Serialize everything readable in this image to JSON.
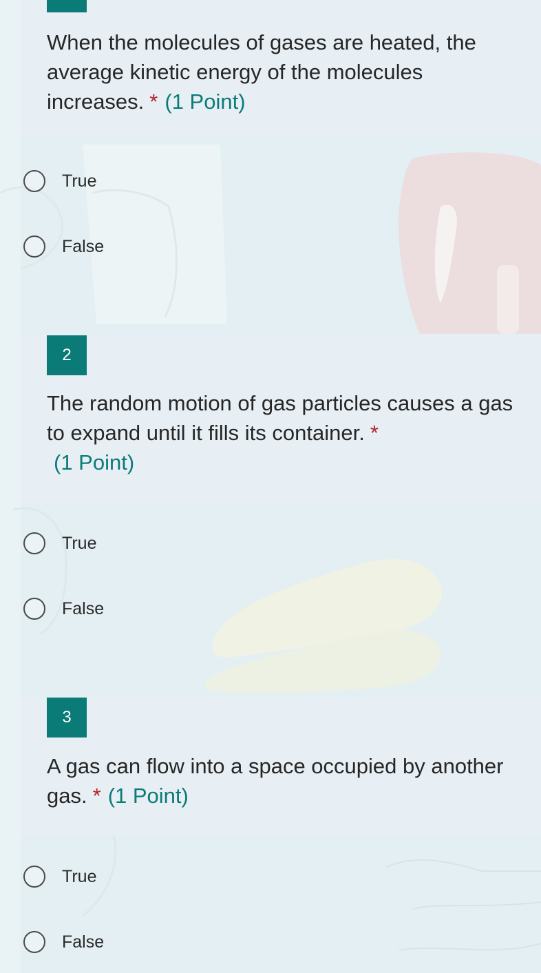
{
  "questions": [
    {
      "number": "",
      "text": "When the molecules of gases are heated, the average kinetic energy of the molecules increases.",
      "required_mark": "*",
      "points": "(1 Point)",
      "options": [
        "True",
        "False"
      ]
    },
    {
      "number": "2",
      "text": "The random motion of gas particles causes a gas to expand until it fills its container.",
      "required_mark": "*",
      "points": "(1 Point)",
      "options": [
        "True",
        "False"
      ]
    },
    {
      "number": "3",
      "text": "A gas can flow into a space occupied by another gas.",
      "required_mark": "*",
      "points": "(1 Point)",
      "options": [
        "True",
        "False"
      ]
    }
  ],
  "colors": {
    "accent": "#0b7b78",
    "required": "#b3262d",
    "card_background": "#e7eff4",
    "page_background": "#e4eff3"
  }
}
